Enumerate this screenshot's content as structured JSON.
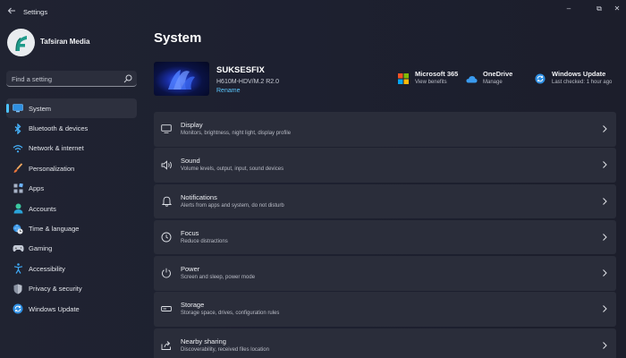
{
  "window": {
    "title": "Settings",
    "controls": {
      "minimize": "–",
      "maximize": "⧉",
      "close": "✕"
    }
  },
  "user": {
    "name": "Tafsiran Media"
  },
  "search": {
    "placeholder": "Find a setting"
  },
  "sidebar": {
    "items": [
      {
        "label": "System",
        "icon": "monitor-icon",
        "active": true
      },
      {
        "label": "Bluetooth & devices",
        "icon": "bluetooth-icon"
      },
      {
        "label": "Network & internet",
        "icon": "wifi-icon"
      },
      {
        "label": "Personalization",
        "icon": "brush-icon"
      },
      {
        "label": "Apps",
        "icon": "apps-icon"
      },
      {
        "label": "Accounts",
        "icon": "person-icon"
      },
      {
        "label": "Time & language",
        "icon": "globe-clock-icon"
      },
      {
        "label": "Gaming",
        "icon": "gamepad-icon"
      },
      {
        "label": "Accessibility",
        "icon": "accessibility-icon"
      },
      {
        "label": "Privacy & security",
        "icon": "shield-icon"
      },
      {
        "label": "Windows Update",
        "icon": "update-icon"
      }
    ]
  },
  "main": {
    "title": "System",
    "device": {
      "name": "SUKSESFIX",
      "model": "H610M-HDV/M.2 R2.0",
      "rename_label": "Rename"
    },
    "quick_links": [
      {
        "title": "Microsoft 365",
        "subtitle": "View benefits",
        "icon": "microsoft-logo-icon"
      },
      {
        "title": "OneDrive",
        "subtitle": "Manage",
        "icon": "cloud-icon"
      },
      {
        "title": "Windows Update",
        "subtitle": "Last checked: 1 hour ago",
        "icon": "update-icon"
      }
    ],
    "rows": [
      {
        "title": "Display",
        "desc": "Monitors, brightness, night light, display profile",
        "icon": "display-icon"
      },
      {
        "title": "Sound",
        "desc": "Volume levels, output, input, sound devices",
        "icon": "speaker-icon"
      },
      {
        "title": "Notifications",
        "desc": "Alerts from apps and system, do not disturb",
        "icon": "bell-icon"
      },
      {
        "title": "Focus",
        "desc": "Reduce distractions",
        "icon": "focus-icon"
      },
      {
        "title": "Power",
        "desc": "Screen and sleep, power mode",
        "icon": "power-icon"
      },
      {
        "title": "Storage",
        "desc": "Storage space, drives, configuration rules",
        "icon": "storage-icon"
      },
      {
        "title": "Nearby sharing",
        "desc": "Discoverability, received files location",
        "icon": "share-icon"
      }
    ]
  },
  "colors": {
    "accent": "#4cc2ff",
    "background": "#1f2230",
    "card": "#2a2d3a"
  }
}
